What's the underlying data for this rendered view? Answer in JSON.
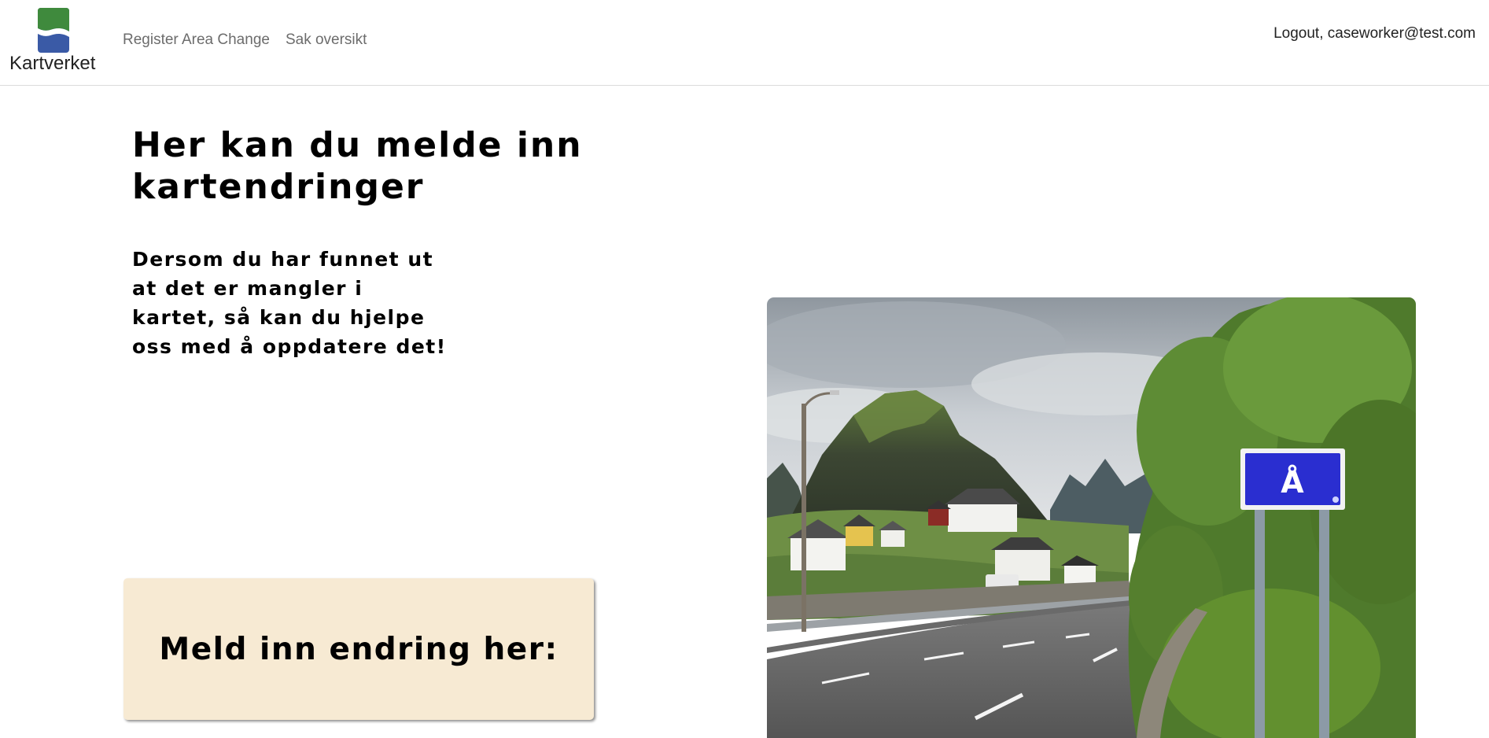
{
  "navbar": {
    "brand_name": "Kartverket",
    "logo_icon": "kartverket-logo-icon",
    "links": [
      {
        "label": "Register Area Change"
      },
      {
        "label": "Sak oversikt"
      }
    ],
    "user_action": "Logout, caseworker@test.com"
  },
  "main": {
    "title": "Her kan du melde inn kartendringer",
    "intro": "Dersom du har funnet ut at det er mangler i kartet, så kan du hjelpe oss med å oppdatere det!",
    "report_button_label": "Meld inn endring her:",
    "photo": {
      "sign_text": "Å",
      "icon": "road-sign-landscape-photo"
    }
  },
  "colors": {
    "logo_green": "#3f8a3d",
    "logo_blue": "#3a5aa6",
    "card_background": "#f7ead3",
    "sign_blue": "#2a2ed0",
    "nav_link_gray": "#6c6c6c"
  }
}
